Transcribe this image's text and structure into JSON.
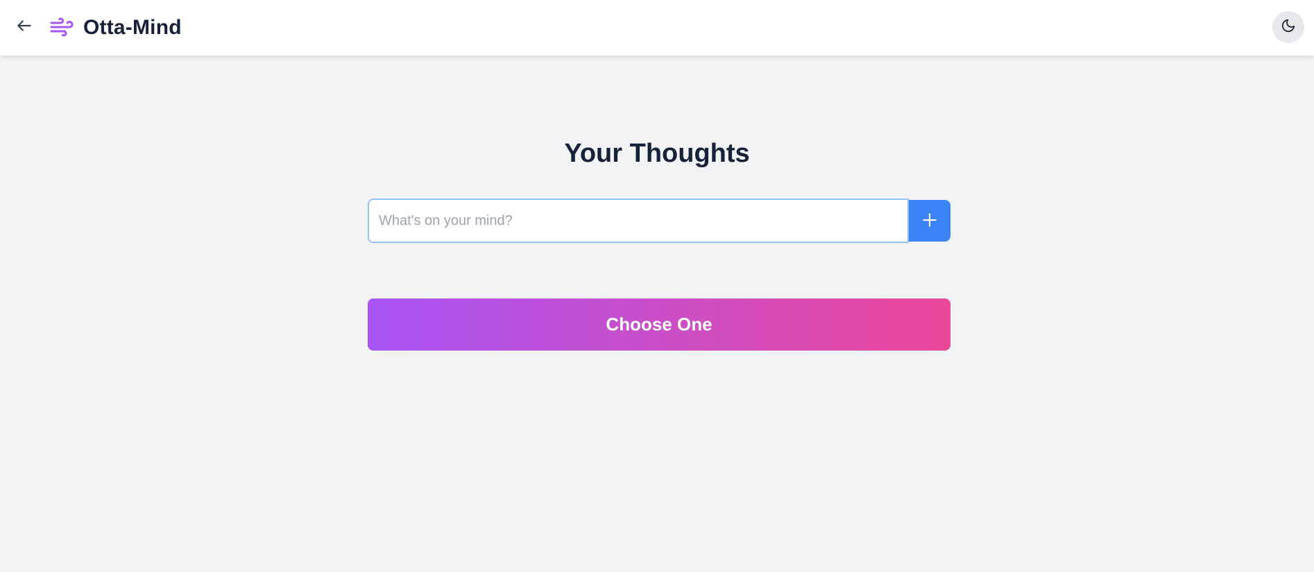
{
  "header": {
    "title": "Otta-Mind",
    "back_icon": "arrow-left-icon",
    "logo_icon": "wind-icon",
    "theme_icon": "moon-icon",
    "logo_color": "#a855f7"
  },
  "main": {
    "title": "Your Thoughts",
    "input": {
      "placeholder": "What's on your mind?",
      "value": ""
    },
    "add_button_icon": "plus-icon",
    "choose_button_label": "Choose One"
  },
  "colors": {
    "accent_blue": "#3b82f6",
    "gradient_start": "#a855f7",
    "gradient_end": "#ec4899",
    "background": "#f2f3f5",
    "text_dark": "#16213a"
  }
}
